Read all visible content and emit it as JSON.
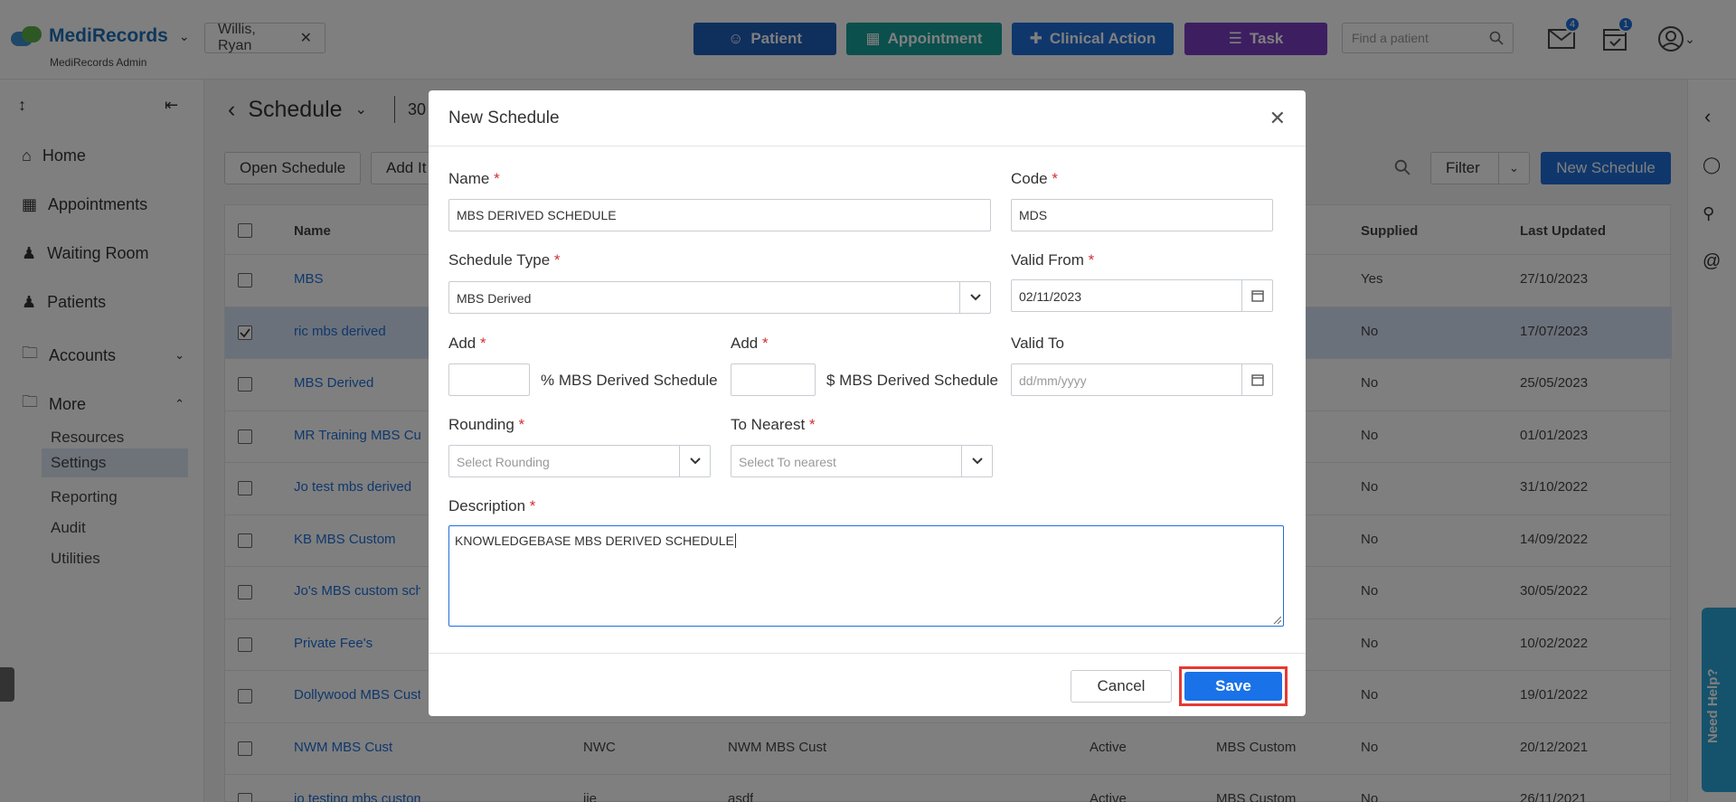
{
  "header": {
    "brand": "MediRecords",
    "sub": "MediRecords Admin",
    "patient_chip": "Willis, Ryan",
    "buttons": {
      "patient": "Patient",
      "appointment": "Appointment",
      "clinical": "Clinical Action",
      "task": "Task"
    },
    "find_placeholder": "Find a patient",
    "mail_badge": "4",
    "tasks_badge": "1"
  },
  "sidebar": {
    "items": [
      {
        "label": "Home"
      },
      {
        "label": "Appointments"
      },
      {
        "label": "Waiting Room"
      },
      {
        "label": "Patients"
      },
      {
        "label": "Accounts"
      },
      {
        "label": "More"
      }
    ],
    "subitems": [
      "Resources",
      "Settings",
      "Reporting",
      "Audit",
      "Utilities"
    ]
  },
  "main": {
    "title": "Schedule",
    "date_fragment": "30",
    "toolbar": {
      "open": "Open Schedule",
      "add": "Add It",
      "filter": "Filter",
      "new": "New Schedule"
    },
    "columns": {
      "name": "Name",
      "supplied": "Supplied",
      "last_updated": "Last Updated"
    },
    "rows": [
      {
        "name": "MBS",
        "col2": "",
        "col3": "",
        "status": "",
        "type": "",
        "supplied": "Yes",
        "updated": "27/10/2023",
        "selected": false
      },
      {
        "name": "ric mbs derived",
        "col2": "",
        "col3": "",
        "status": "",
        "type": "",
        "supplied": "No",
        "updated": "17/07/2023",
        "selected": true
      },
      {
        "name": "MBS Derived",
        "col2": "",
        "col3": "",
        "status": "",
        "type": "",
        "supplied": "No",
        "updated": "25/05/2023",
        "selected": false
      },
      {
        "name": "MR Training MBS Custo",
        "col2": "",
        "col3": "",
        "status": "",
        "type": "",
        "supplied": "No",
        "updated": "01/01/2023",
        "selected": false
      },
      {
        "name": "Jo test mbs derived",
        "col2": "",
        "col3": "",
        "status": "",
        "type": "",
        "supplied": "No",
        "updated": "31/10/2022",
        "selected": false
      },
      {
        "name": "KB MBS Custom",
        "col2": "",
        "col3": "",
        "status": "",
        "type": "",
        "supplied": "No",
        "updated": "14/09/2022",
        "selected": false
      },
      {
        "name": "Jo's MBS custom sched",
        "col2": "",
        "col3": "",
        "status": "",
        "type": "",
        "supplied": "No",
        "updated": "30/05/2022",
        "selected": false
      },
      {
        "name": "Private Fee's",
        "col2": "",
        "col3": "",
        "status": "",
        "type": "",
        "supplied": "No",
        "updated": "10/02/2022",
        "selected": false
      },
      {
        "name": "Dollywood MBS Custor",
        "col2": "",
        "col3": "",
        "status": "",
        "type": "",
        "supplied": "No",
        "updated": "19/01/2022",
        "selected": false
      },
      {
        "name": "NWM MBS Cust",
        "col2": "NWC",
        "col3": "NWM MBS Cust",
        "status": "Active",
        "type": "MBS Custom",
        "supplied": "No",
        "updated": "20/12/2021",
        "selected": false
      },
      {
        "name": "jo testing mbs custom",
        "col2": "jie",
        "col3": "asdf",
        "status": "Active",
        "type": "MBS Custom",
        "supplied": "No",
        "updated": "26/11/2021",
        "selected": false
      }
    ]
  },
  "help": "Need Help?",
  "modal": {
    "title": "New Schedule",
    "name_label": "Name",
    "name_value": "MBS DERIVED SCHEDULE",
    "code_label": "Code",
    "code_value": "MDS",
    "type_label": "Schedule Type",
    "type_value": "MBS Derived",
    "valid_from_label": "Valid From",
    "valid_from_value": "02/11/2023",
    "add_pct_label": "Add",
    "add_pct_suffix": "% MBS Derived Schedule",
    "add_amt_label": "Add",
    "add_amt_suffix": "$ MBS Derived Schedule",
    "valid_to_label": "Valid To",
    "valid_to_placeholder": "dd/mm/yyyy",
    "rounding_label": "Rounding",
    "rounding_placeholder": "Select Rounding",
    "nearest_label": "To Nearest",
    "nearest_placeholder": "Select To nearest",
    "desc_label": "Description",
    "desc_value": "KNOWLEDGEBASE MBS DERIVED SCHEDULE",
    "cancel": "Cancel",
    "save": "Save"
  },
  "colors": {
    "primary": "#1f6fd8",
    "required": "#d32f2f",
    "highlight": "#e53935"
  }
}
